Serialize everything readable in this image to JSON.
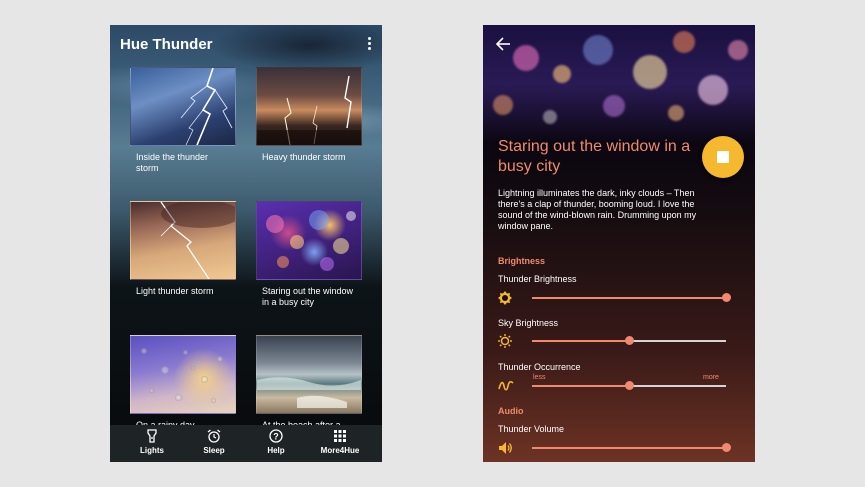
{
  "left_screen": {
    "app_title": "Hue Thunder",
    "tiles": [
      {
        "label": "Inside the thunder storm",
        "image": "lightning-blue"
      },
      {
        "label": "Heavy thunder storm",
        "image": "lightning-sunset"
      },
      {
        "label": "Light thunder storm",
        "image": "lightning-orange-sky"
      },
      {
        "label": "Staring out the window in a busy city",
        "image": "bokeh-city-lights"
      },
      {
        "label": "On a rainy day",
        "image": "raindrops-window"
      },
      {
        "label": "At the beach after a",
        "image": "stormy-beach"
      }
    ],
    "nav": [
      {
        "label": "Lights",
        "icon": "flashlight-icon"
      },
      {
        "label": "Sleep",
        "icon": "alarm-clock-icon"
      },
      {
        "label": "Help",
        "icon": "help-circle-icon"
      },
      {
        "label": "More4Hue",
        "icon": "grid-icon"
      }
    ]
  },
  "right_screen": {
    "title": "Staring out the window in a busy city",
    "description": "Lightning illuminates the dark, inky clouds – Then there's a clap of thunder, booming loud. I love the sound of the wind-blown rain. Drumming upon my window pane.",
    "sections": {
      "brightness": "Brightness",
      "audio": "Audio"
    },
    "settings": {
      "thunder_brightness": {
        "label": "Thunder Brightness",
        "value": 1.0,
        "icon": "brightness-icon"
      },
      "sky_brightness": {
        "label": "Sky Brightness",
        "value": 0.5,
        "icon": "sun-icon"
      },
      "thunder_occurrence": {
        "label": "Thunder Occurrence",
        "value": 0.5,
        "min_label": "less",
        "max_label": "more",
        "icon": "wave-icon"
      },
      "thunder_volume": {
        "label": "Thunder Volume",
        "value": 1.0,
        "icon": "volume-icon"
      }
    },
    "colors": {
      "accent": "#ef8a70",
      "stop_button": "#f5b82e"
    }
  }
}
